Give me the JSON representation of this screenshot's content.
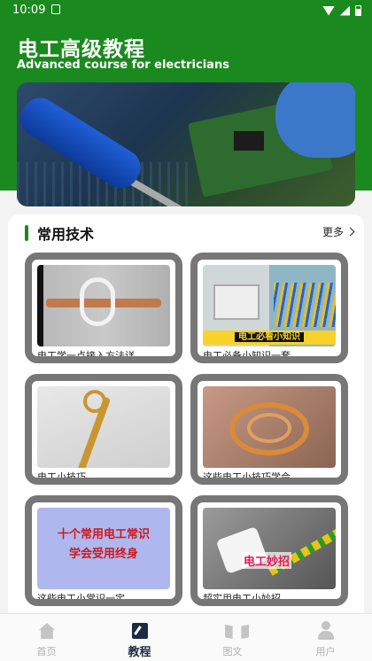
{
  "status_bar": {
    "time": "10:09"
  },
  "header": {
    "title": "电工高级教程",
    "subtitle": "Advanced course for electricians"
  },
  "section": {
    "title": "常用技术",
    "more_label": "更多"
  },
  "tiles": [
    {
      "caption": "电工学一点接入方法详"
    },
    {
      "caption": "电工必备小知识一套",
      "thumb_label": "电工必看小知识"
    },
    {
      "caption": "电工小技巧"
    },
    {
      "caption": "这些电工小技巧学会"
    },
    {
      "caption": "这些电工小常识一定",
      "thumb_text": [
        "十个常用电工常识",
        "学会受用终身"
      ]
    },
    {
      "caption": "超实用电工小妙招",
      "thumb_label": "电工妙招"
    }
  ],
  "tabbar": {
    "items": [
      {
        "label": "首页",
        "icon": "home-icon",
        "active": false
      },
      {
        "label": "教程",
        "icon": "course-icon",
        "active": true
      },
      {
        "label": "图文",
        "icon": "book-icon",
        "active": false
      },
      {
        "label": "用户",
        "icon": "user-icon",
        "active": false
      }
    ]
  },
  "colors": {
    "brand_green": "#1a8a1e",
    "tile_border": "#777777",
    "active_tab": "#1f2a44"
  }
}
